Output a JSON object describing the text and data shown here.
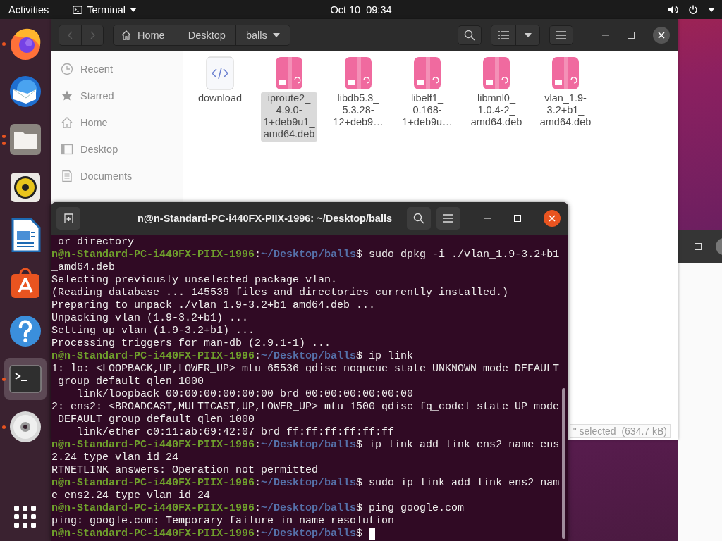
{
  "top_bar": {
    "activities": "Activities",
    "app_menu": "Terminal",
    "clock": "Oct 10  09:34"
  },
  "dock": [
    {
      "kind": "browser",
      "running": true,
      "two_windows": false,
      "selected": false
    },
    {
      "kind": "mail",
      "running": false,
      "two_windows": false,
      "selected": false
    },
    {
      "kind": "files",
      "running": true,
      "two_windows": true,
      "selected": false
    },
    {
      "kind": "music",
      "running": false,
      "two_windows": false,
      "selected": false
    },
    {
      "kind": "writer",
      "running": false,
      "two_windows": false,
      "selected": false
    },
    {
      "kind": "store",
      "running": false,
      "two_windows": false,
      "selected": false
    },
    {
      "kind": "help",
      "running": false,
      "two_windows": false,
      "selected": false
    },
    {
      "kind": "terminal",
      "running": true,
      "two_windows": false,
      "selected": true
    },
    {
      "kind": "disc",
      "running": true,
      "two_windows": false,
      "selected": false
    }
  ],
  "file_manager": {
    "nav": {
      "back_disabled": true,
      "forward_disabled": true
    },
    "path": [
      {
        "label": "Home",
        "kind": "home",
        "dropdown": false
      },
      {
        "label": "Desktop",
        "kind": "folder",
        "dropdown": false
      },
      {
        "label": "balls",
        "kind": "folder",
        "dropdown": true
      }
    ],
    "sidebar": [
      {
        "label": "Recent",
        "kind": "recent"
      },
      {
        "label": "Starred",
        "kind": "starred"
      },
      {
        "label": "Home",
        "kind": "home"
      },
      {
        "label": "Desktop",
        "kind": "desktop"
      },
      {
        "label": "Documents",
        "kind": "documents"
      }
    ],
    "files": [
      {
        "kind": "code",
        "label_lines": [
          "download"
        ],
        "selected": false
      },
      {
        "kind": "package",
        "label_lines": [
          "iproute2_",
          "4.9.0-",
          "1+deb9u1_",
          "amd64.deb"
        ],
        "selected": true
      },
      {
        "kind": "package",
        "label_lines": [
          "libdb5.3_",
          "5.3.28-",
          "12+deb9…"
        ],
        "selected": false
      },
      {
        "kind": "package",
        "label_lines": [
          "libelf1_",
          "0.168-",
          "1+deb9u…"
        ],
        "selected": false
      },
      {
        "kind": "package",
        "label_lines": [
          "libmnl0_",
          "1.0.4-2_",
          "amd64.deb"
        ],
        "selected": false
      },
      {
        "kind": "package",
        "label_lines": [
          "vlan_1.9-",
          "3.2+b1_",
          "amd64.deb"
        ],
        "selected": false
      }
    ],
    "status": "\" selected  (634.7 kB)"
  },
  "terminal": {
    "title": "n@n-Standard-PC-i440FX-PIIX-1996: ~/Desktop/balls",
    "lines": [
      {
        "kind": "output",
        "text": " or directory"
      },
      {
        "kind": "prompt",
        "user": "n@n-Standard-PC-i440FX-PIIX-1996",
        "sep": ":",
        "path": "~/Desktop/balls",
        "command": "$ sudo dpkg -i ./vlan_1.9-3.2+b1",
        "cursor": false
      },
      {
        "kind": "output",
        "text": "_amd64.deb"
      },
      {
        "kind": "output",
        "text": "Selecting previously unselected package vlan."
      },
      {
        "kind": "output",
        "text": "(Reading database ... 145539 files and directories currently installed.)"
      },
      {
        "kind": "output",
        "text": "Preparing to unpack ./vlan_1.9-3.2+b1_amd64.deb ..."
      },
      {
        "kind": "output",
        "text": "Unpacking vlan (1.9-3.2+b1) ..."
      },
      {
        "kind": "output",
        "text": "Setting up vlan (1.9-3.2+b1) ..."
      },
      {
        "kind": "output",
        "text": "Processing triggers for man-db (2.9.1-1) ..."
      },
      {
        "kind": "prompt",
        "user": "n@n-Standard-PC-i440FX-PIIX-1996",
        "sep": ":",
        "path": "~/Desktop/balls",
        "command": "$ ip link",
        "cursor": false
      },
      {
        "kind": "output",
        "text": "1: lo: <LOOPBACK,UP,LOWER_UP> mtu 65536 qdisc noqueue state UNKNOWN mode DEFAULT"
      },
      {
        "kind": "output",
        "text": " group default qlen 1000"
      },
      {
        "kind": "output",
        "text": "    link/loopback 00:00:00:00:00:00 brd 00:00:00:00:00:00"
      },
      {
        "kind": "output",
        "text": "2: ens2: <BROADCAST,MULTICAST,UP,LOWER_UP> mtu 1500 qdisc fq_codel state UP mode"
      },
      {
        "kind": "output",
        "text": " DEFAULT group default qlen 1000"
      },
      {
        "kind": "output",
        "text": "    link/ether c0:11:ab:69:42:07 brd ff:ff:ff:ff:ff:ff"
      },
      {
        "kind": "prompt",
        "user": "n@n-Standard-PC-i440FX-PIIX-1996",
        "sep": ":",
        "path": "~/Desktop/balls",
        "command": "$ ip link add link ens2 name ens",
        "cursor": false
      },
      {
        "kind": "output",
        "text": "2.24 type vlan id 24"
      },
      {
        "kind": "output",
        "text": "RTNETLINK answers: Operation not permitted"
      },
      {
        "kind": "prompt",
        "user": "n@n-Standard-PC-i440FX-PIIX-1996",
        "sep": ":",
        "path": "~/Desktop/balls",
        "command": "$ sudo ip link add link ens2 nam",
        "cursor": false
      },
      {
        "kind": "output",
        "text": "e ens2.24 type vlan id 24"
      },
      {
        "kind": "prompt",
        "user": "n@n-Standard-PC-i440FX-PIIX-1996",
        "sep": ":",
        "path": "~/Desktop/balls",
        "command": "$ ping google.com",
        "cursor": false
      },
      {
        "kind": "output",
        "text": "ping: google.com: Temporary failure in name resolution"
      },
      {
        "kind": "prompt",
        "user": "n@n-Standard-PC-i440FX-PIIX-1996",
        "sep": ":",
        "path": "~/Desktop/balls",
        "command": "$ ",
        "cursor": true
      }
    ]
  }
}
